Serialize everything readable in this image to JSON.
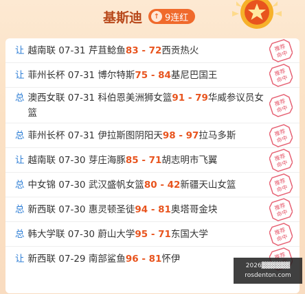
{
  "header": {
    "title": "基斯迪",
    "streak_label": "9连红",
    "streak_icon": "up-arrow-circle-icon",
    "medal_icon": "star-medal-icon"
  },
  "stamp_text": "推荐命中",
  "colors": {
    "type_label": "#2f7fd6",
    "score": "#e8541e",
    "streak_bg": "#f06a2c",
    "stamp": "#e2455a"
  },
  "rows": [
    {
      "type": "让",
      "league": "越南联",
      "date": "07-31",
      "home": "芹苴鲶鱼",
      "score": "83 - 72",
      "away": "西贡热火"
    },
    {
      "type": "让",
      "league": "菲州长杯",
      "date": "07-31",
      "home": "博尔特斯",
      "score": "75 - 84",
      "away": "基尼巴国王"
    },
    {
      "type": "总",
      "league": "澳西女联",
      "date": "07-31",
      "home": "科伯恩美洲狮女篮",
      "score": "91 - 79",
      "away": "华威参议员女篮"
    },
    {
      "type": "总",
      "league": "菲州长杯",
      "date": "07-31",
      "home": "伊拉斯图阴阳天",
      "score": "98 - 97",
      "away": "拉马多斯"
    },
    {
      "type": "让",
      "league": "越南联",
      "date": "07-30",
      "home": "芽庄海豚",
      "score": "85 - 71",
      "away": "胡志明市飞翼"
    },
    {
      "type": "总",
      "league": "中女锦",
      "date": "07-30",
      "home": "武汉盛帆女篮",
      "score": "80 - 42",
      "away": "新疆天山女篮"
    },
    {
      "type": "总",
      "league": "新西联",
      "date": "07-30",
      "home": "惠灵顿圣徒",
      "score": "94 - 81",
      "away": "奥塔哥金块"
    },
    {
      "type": "总",
      "league": "韩大学联",
      "date": "07-30",
      "home": "蔚山大学",
      "score": "95 - 71",
      "away": "东国大学"
    },
    {
      "type": "让",
      "league": "新西联",
      "date": "07-29",
      "home": "南部鲨鱼",
      "score": "96 - 81",
      "away": "怀伊"
    }
  ],
  "watermark": {
    "line1": "2026▓▓▓▓▓▓",
    "line2": "rosdenton.com"
  }
}
